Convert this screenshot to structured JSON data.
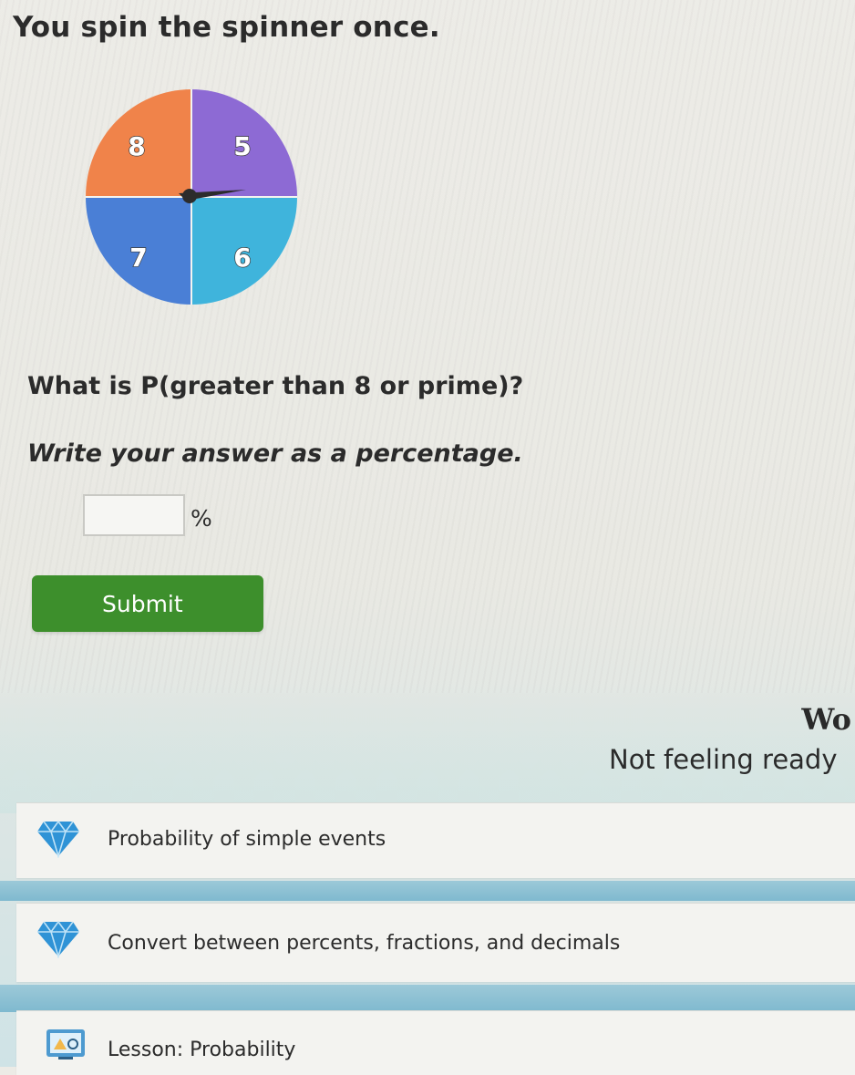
{
  "question": {
    "title": "You spin the spinner once.",
    "prompt": "What is P(greater than 8 or prime)?",
    "instruction": "Write your answer as a percentage.",
    "answer_value": "",
    "percent_sign": "%",
    "submit_label": "Submit"
  },
  "spinner": {
    "sections": [
      {
        "label": "8",
        "color": "#f0834a"
      },
      {
        "label": "5",
        "color": "#8d6ad4"
      },
      {
        "label": "6",
        "color": "#3fb4dc"
      },
      {
        "label": "7",
        "color": "#4a7fd6"
      }
    ]
  },
  "help": {
    "heading": "Wo",
    "not_ready": "Not feeling ready",
    "items": [
      {
        "label": "Probability of simple events",
        "icon": "diamond-icon"
      },
      {
        "label": "Convert between percents, fractions, and decimals",
        "icon": "diamond-icon"
      },
      {
        "label": "Lesson: Probability",
        "icon": "lesson-icon"
      }
    ]
  },
  "colors": {
    "submit": "#3d8f2c",
    "gem": "#2f93d6",
    "teal_band": "#8cc1d4"
  }
}
